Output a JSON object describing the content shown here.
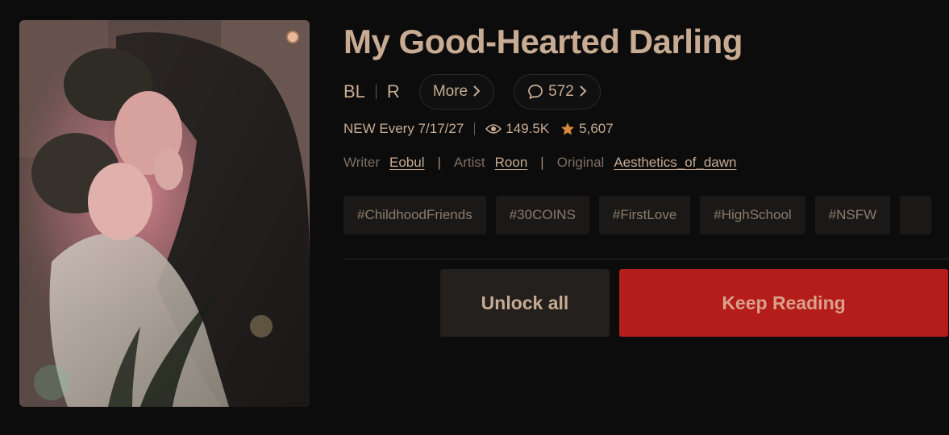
{
  "series": {
    "title": "My Good-Hearted Darling",
    "genre": "BL",
    "age_rating": "R",
    "more_label": "More",
    "comment_count": "572",
    "schedule": "NEW Every 7/17/27",
    "views": "149.5K",
    "likes": "5,607"
  },
  "credits": {
    "writer_label": "Writer",
    "writer": "Eobul",
    "artist_label": "Artist",
    "artist": "Roon",
    "original_label": "Original",
    "original": "Aesthetics_of_dawn",
    "separator": "|"
  },
  "tags": [
    "#ChildhoodFriends",
    "#30COINS",
    "#FirstLove",
    "#HighSchool",
    "#NSFW"
  ],
  "actions": {
    "unlock_label": "Unlock all",
    "keep_reading_label": "Keep Reading"
  },
  "icons": {
    "comment": "speech-bubble-icon",
    "views": "eye-icon",
    "likes": "star-icon",
    "chevron": "chevron-right-icon"
  },
  "colors": {
    "background": "#0c0c0c",
    "accent_text": "#c7ab92",
    "primary_button": "#b51d1a",
    "secondary_button": "#24201d",
    "star": "#d88a3a"
  }
}
